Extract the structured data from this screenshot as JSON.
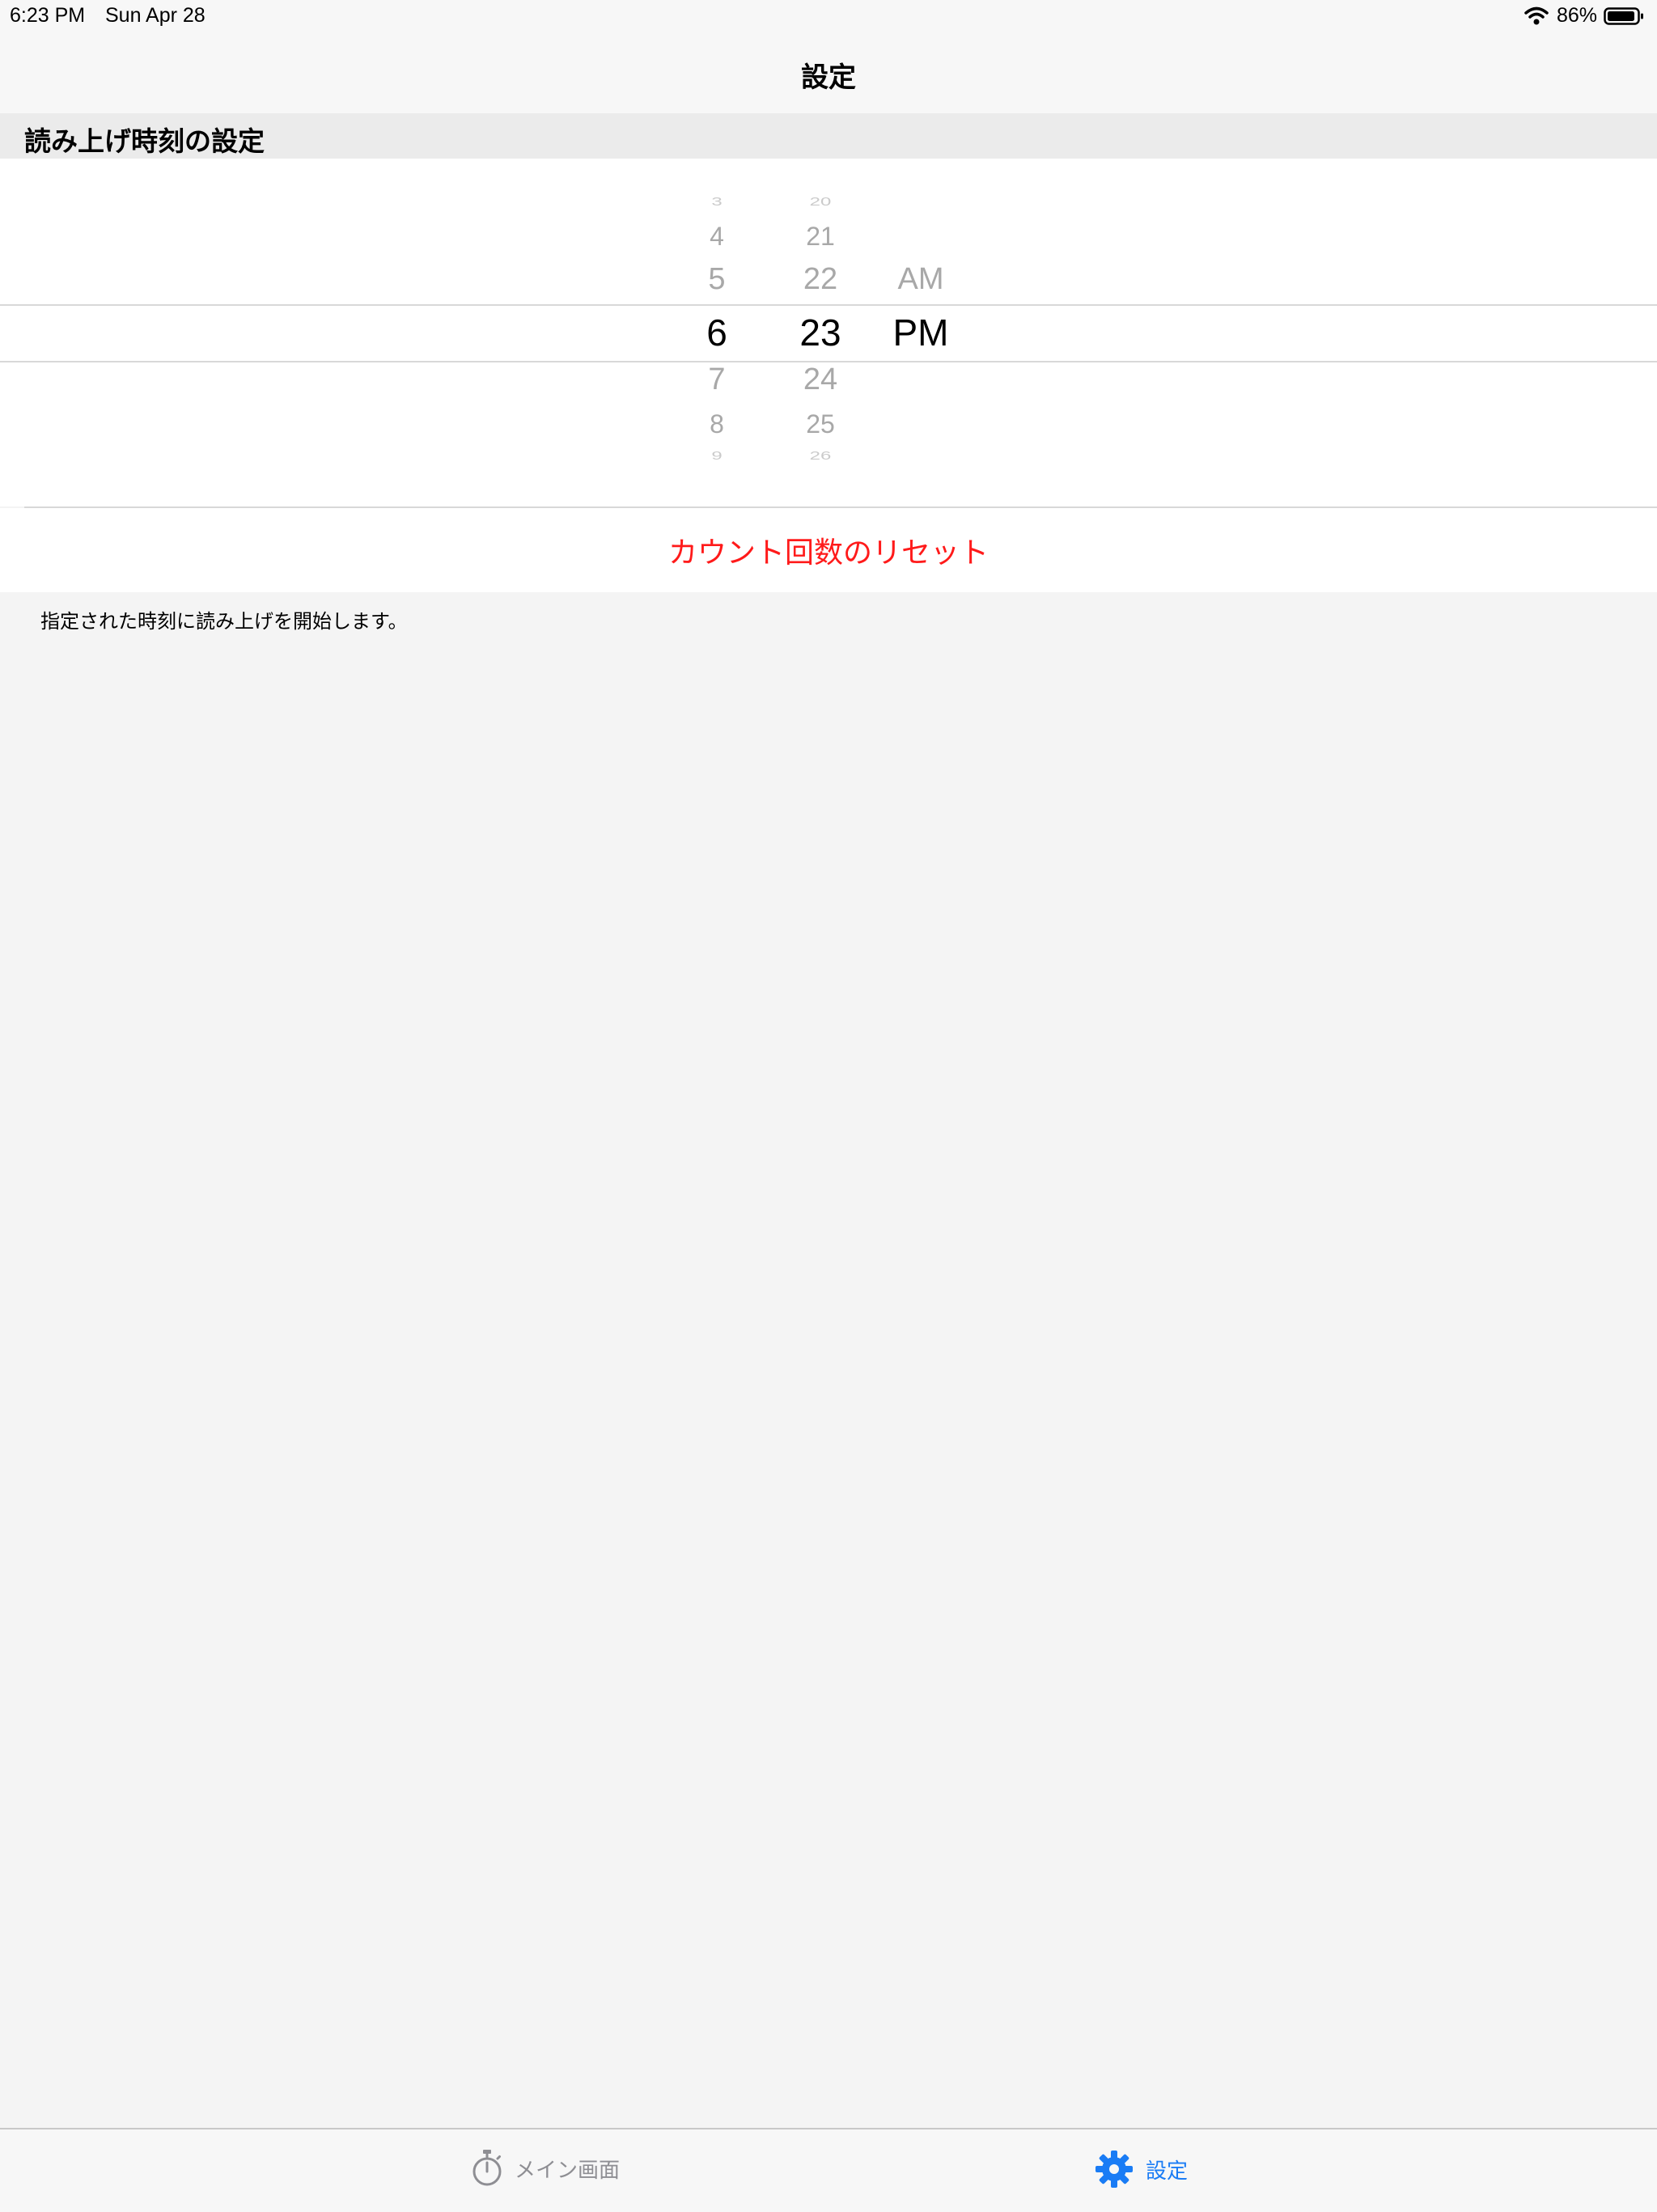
{
  "status_bar": {
    "time": "6:23 PM",
    "date": "Sun Apr 28",
    "battery": "86%",
    "icons": [
      "wifi-icon",
      "battery-icon"
    ]
  },
  "nav": {
    "title": "設定"
  },
  "section": {
    "header": "読み上げ時刻の設定"
  },
  "picker": {
    "hours": [
      "3",
      "4",
      "5",
      "6",
      "7",
      "8",
      "9"
    ],
    "minutes": [
      "20",
      "21",
      "22",
      "23",
      "24",
      "25",
      "26"
    ],
    "meridiem": [
      "AM",
      "PM"
    ],
    "selected": {
      "hour": "6",
      "minute": "23",
      "meridiem": "PM"
    }
  },
  "reset": {
    "label": "カウント回数のリセット"
  },
  "footer": {
    "note": "指定された時刻に読み上げを開始します。"
  },
  "tabs": [
    {
      "label": "メイン画面",
      "icon": "stopwatch-icon",
      "active": false
    },
    {
      "label": "設定",
      "icon": "gear-icon",
      "active": true
    }
  ],
  "colors": {
    "accent": "#1a7cf5",
    "destructive": "#ff1a1a",
    "inactive": "#8e8e93"
  }
}
